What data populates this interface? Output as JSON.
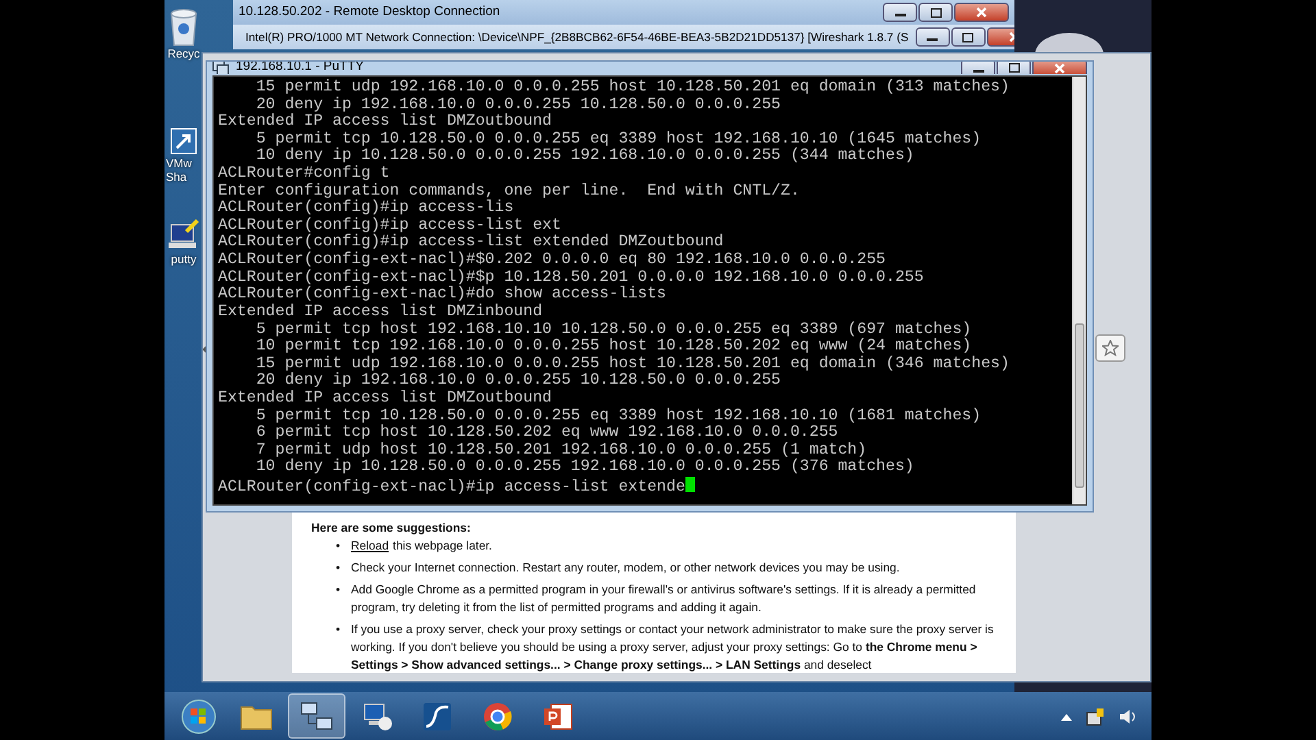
{
  "desktop_icons": [
    {
      "kind": "recycle",
      "label": "Recyc"
    },
    {
      "kind": "shortcut",
      "label": "VMw Sha"
    },
    {
      "kind": "putty",
      "label": "putty"
    }
  ],
  "remote_desktop": {
    "title": "10.128.50.202 - Remote Desktop Connection"
  },
  "wireshark": {
    "title": "Intel(R) PRO/1000 MT Network Connection: \\Device\\NPF_{2B8BCB62-6F54-46BE-BEA3-5B2D21DD5137}   [Wireshark 1.8.7  (S"
  },
  "putty": {
    "title": "192.168.10.1 - PuTTY",
    "cursor_visible": true,
    "lines": [
      "    15 permit udp 192.168.10.0 0.0.0.255 host 10.128.50.201 eq domain (313 matches)",
      "    20 deny ip 192.168.10.0 0.0.0.255 10.128.50.0 0.0.0.255",
      "Extended IP access list DMZoutbound",
      "    5 permit tcp 10.128.50.0 0.0.0.255 eq 3389 host 192.168.10.10 (1645 matches)",
      "    10 deny ip 10.128.50.0 0.0.0.255 192.168.10.0 0.0.0.255 (344 matches)",
      "ACLRouter#config t",
      "Enter configuration commands, one per line.  End with CNTL/Z.",
      "ACLRouter(config)#ip access-lis",
      "ACLRouter(config)#ip access-list ext",
      "ACLRouter(config)#ip access-list extended DMZoutbound",
      "ACLRouter(config-ext-nacl)#$0.202 0.0.0.0 eq 80 192.168.10.0 0.0.0.255",
      "ACLRouter(config-ext-nacl)#$p 10.128.50.201 0.0.0.0 192.168.10.0 0.0.0.255",
      "ACLRouter(config-ext-nacl)#do show access-lists",
      "Extended IP access list DMZinbound",
      "    5 permit tcp host 192.168.10.10 10.128.50.0 0.0.0.255 eq 3389 (697 matches)",
      "    10 permit tcp 192.168.10.0 0.0.0.255 host 10.128.50.202 eq www (24 matches)",
      "    15 permit udp 192.168.10.0 0.0.0.255 host 10.128.50.201 eq domain (346 matches)",
      "    20 deny ip 192.168.10.0 0.0.0.255 10.128.50.0 0.0.0.255",
      "Extended IP access list DMZoutbound",
      "    5 permit tcp 10.128.50.0 0.0.0.255 eq 3389 host 192.168.10.10 (1681 matches)",
      "    6 permit tcp host 10.128.50.202 eq www 192.168.10.0 0.0.0.255",
      "    7 permit udp host 10.128.50.201 192.168.10.0 0.0.0.255 (1 match)",
      "    10 deny ip 10.128.50.0 0.0.0.255 192.168.10.0 0.0.0.255 (376 matches)",
      "ACLRouter(config-ext-nacl)#ip access-list extende"
    ]
  },
  "chrome_page": {
    "heading": "Here are some suggestions:",
    "suggestions": [
      {
        "bullet": "•",
        "link": "Reload",
        "text": "this webpage later."
      },
      {
        "bullet": "•",
        "text": "Check your Internet connection. Restart any router, modem, or other network devices you may be using."
      },
      {
        "bullet": "•",
        "text": "Add Google Chrome as a permitted program in your firewall's or antivirus software's settings. If it is already a permitted program, try deleting it from the list of permitted programs and adding it again."
      },
      {
        "bullet": "•",
        "text": "If you use a proxy server, check your proxy settings or contact your network administrator to make sure the proxy server is working. If you don't believe you should be using a proxy server, adjust your proxy settings: Go to **the Chrome menu > Settings > Show advanced settings... > Change proxy settings... > LAN Settings** and deselect"
      }
    ]
  },
  "taskbar": {
    "apps": [
      {
        "kind": "folder",
        "active": false
      },
      {
        "kind": "network",
        "active": true
      },
      {
        "kind": "remote",
        "active": false
      },
      {
        "kind": "wireshark",
        "active": false
      },
      {
        "kind": "chrome",
        "active": false
      },
      {
        "kind": "powerpoint",
        "active": false
      }
    ]
  }
}
